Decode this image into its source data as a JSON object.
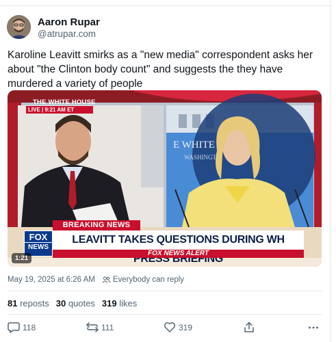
{
  "author": {
    "name": "Aaron Rupar",
    "handle": "@atrupar.com"
  },
  "post": {
    "text": "Karoline Leavitt smirks as a \"new media\" correspondent asks her about \"the Clinton body count\" and suggests the they have murdered a variety of people",
    "date": "May 19, 2025 at 6:26 AM",
    "reply_setting": "Everybody can reply"
  },
  "video": {
    "location_label": "THE WHITE HOUSE",
    "live_label": "LIVE | 9:21 AM ET",
    "breaking_label": "BREAKING NEWS",
    "headline": "LEAVITT TAKES QUESTIONS DURING WH PRESS BRIEFING",
    "alert_label": "FOX NEWS ALERT",
    "logo_top": "FOX",
    "logo_bottom": "NEWS",
    "duration": "1:21",
    "background_text": "E WHITE HO",
    "background_subtext": "WASHINGTO"
  },
  "stats": {
    "reposts_count": "81",
    "reposts_label": "reposts",
    "quotes_count": "30",
    "quotes_label": "quotes",
    "likes_count": "319",
    "likes_label": "likes"
  },
  "actions": {
    "reply_count": "118",
    "repost_count": "111",
    "like_count": "319"
  },
  "icons": [
    "reply-icon",
    "repost-icon",
    "like-icon",
    "share-icon",
    "more-icon",
    "people-icon"
  ],
  "colors": {
    "text": "#0f1419",
    "muted": "#536471",
    "fox_red": "#c8102e",
    "fox_blue": "#0b3a8c"
  }
}
